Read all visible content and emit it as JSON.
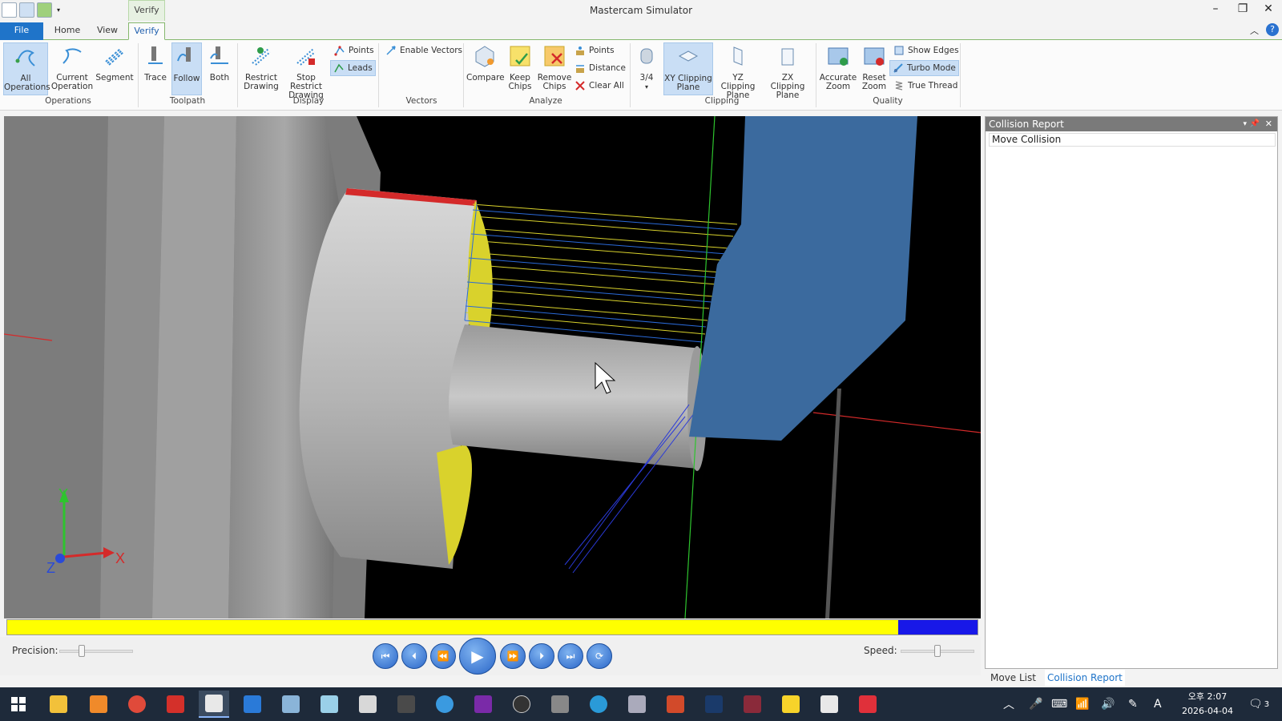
{
  "window": {
    "title": "Mastercam Simulator",
    "context_tab": "Verify",
    "minimize_icon": "minimize-icon",
    "restore_icon": "restore-icon",
    "close_icon": "close-icon"
  },
  "tabs": [
    {
      "label": "File"
    },
    {
      "label": "Home"
    },
    {
      "label": "View"
    },
    {
      "label": "Verify",
      "active": true
    }
  ],
  "ribbon": {
    "operations": {
      "group": "Operations",
      "all_operations": "All Operations",
      "current_operation": "Current Operation",
      "segment": "Segment"
    },
    "toolpath": {
      "group": "Toolpath",
      "trace": "Trace",
      "follow": "Follow",
      "both": "Both"
    },
    "display": {
      "group": "Display",
      "restrict_drawing": "Restrict Drawing",
      "stop_restrict_drawing": "Stop Restrict Drawing",
      "points": "Points",
      "leads": "Leads"
    },
    "vectors": {
      "group": "Vectors",
      "enable_vectors": "Enable Vectors"
    },
    "analyze": {
      "group": "Analyze",
      "compare": "Compare",
      "keep_chips": "Keep Chips",
      "remove_chips": "Remove Chips",
      "points": "Points",
      "distance": "Distance",
      "clear_all": "Clear All"
    },
    "clipping": {
      "group": "Clipping",
      "three_quarter": "3/4",
      "xy_plane": "XY Clipping Plane",
      "yz_plane": "YZ Clipping Plane",
      "zx_plane": "ZX Clipping Plane"
    },
    "quality": {
      "group": "Quality",
      "accurate_zoom": "Accurate Zoom",
      "reset_zoom": "Reset Zoom",
      "show_edges": "Show Edges",
      "turbo_mode": "Turbo Mode",
      "true_thread": "True Thread"
    }
  },
  "viewport": {
    "axis_x": "X",
    "axis_y": "Y",
    "axis_z": "Z"
  },
  "progress": {
    "fraction": 0.918,
    "fill_color": "#ffff00",
    "remaining_color": "#1818e8"
  },
  "playback": {
    "precision_label": "Precision:",
    "speed_label": "Speed:",
    "precision_level": 0.28,
    "speed_level": 0.5,
    "buttons": [
      "skip-to-start-icon",
      "step-back-icon",
      "rewind-icon",
      "play-icon",
      "fast-forward-icon",
      "step-forward-icon",
      "skip-to-end-icon",
      "loop-icon"
    ]
  },
  "side_panel": {
    "title": "Collision Report",
    "column_header": "Move Collision",
    "tabs": [
      "Move List",
      "Collision Report"
    ]
  },
  "taskbar": {
    "clock_time": "오후 2:07",
    "clock_date": "2026-04-04",
    "notification_count": "3",
    "ime_label": "A"
  }
}
